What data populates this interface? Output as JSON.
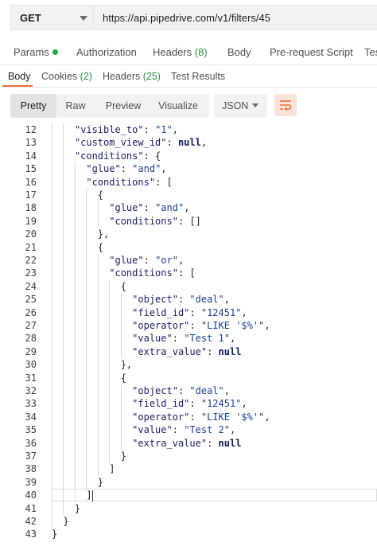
{
  "request": {
    "method": "GET",
    "url": "https://api.pipedrive.com/v1/filters/45"
  },
  "request_tabs": [
    {
      "label": "Params",
      "count": "",
      "dot": true
    },
    {
      "label": "Authorization",
      "count": "",
      "dot": false
    },
    {
      "label": "Headers",
      "count": "(8)",
      "dot": false
    },
    {
      "label": "Body",
      "count": "",
      "dot": false
    },
    {
      "label": "Pre-request Script",
      "count": "",
      "dot": false
    },
    {
      "label": "Tes",
      "count": "",
      "dot": false
    }
  ],
  "response_tabs": [
    {
      "label": "Body",
      "count": "",
      "active": true
    },
    {
      "label": "Cookies",
      "count": "(2)",
      "active": false
    },
    {
      "label": "Headers",
      "count": "(25)",
      "active": false
    },
    {
      "label": "Test Results",
      "count": "",
      "active": false
    }
  ],
  "format_modes": [
    {
      "label": "Pretty",
      "active": true
    },
    {
      "label": "Raw",
      "active": false
    },
    {
      "label": "Preview",
      "active": false
    },
    {
      "label": "Visualize",
      "active": false
    }
  ],
  "language": "JSON",
  "wrap_icon": "wrap-lines-icon",
  "colors": {
    "accent": "#f26b3a",
    "count_green": "#2f9142",
    "dot_green": "#27a844",
    "json_key": "#1c1c6b",
    "json_string": "#1c3f96",
    "json_null": "#0b1a63"
  },
  "code_lines": [
    {
      "n": "12",
      "indent": 4,
      "tokens": [
        [
          "k",
          "\"visible_to\""
        ],
        [
          "p",
          ": "
        ],
        [
          "s",
          "\"1\""
        ],
        [
          "p",
          ","
        ]
      ]
    },
    {
      "n": "13",
      "indent": 4,
      "tokens": [
        [
          "k",
          "\"custom_view_id\""
        ],
        [
          "p",
          ": "
        ],
        [
          "n",
          "null"
        ],
        [
          "p",
          ","
        ]
      ]
    },
    {
      "n": "14",
      "indent": 4,
      "tokens": [
        [
          "k",
          "\"conditions\""
        ],
        [
          "p",
          ": {"
        ]
      ]
    },
    {
      "n": "15",
      "indent": 6,
      "tokens": [
        [
          "k",
          "\"glue\""
        ],
        [
          "p",
          ": "
        ],
        [
          "s",
          "\"and\""
        ],
        [
          "p",
          ","
        ]
      ]
    },
    {
      "n": "16",
      "indent": 6,
      "tokens": [
        [
          "k",
          "\"conditions\""
        ],
        [
          "p",
          ": ["
        ]
      ]
    },
    {
      "n": "17",
      "indent": 8,
      "tokens": [
        [
          "p",
          "{"
        ]
      ]
    },
    {
      "n": "18",
      "indent": 10,
      "tokens": [
        [
          "k",
          "\"glue\""
        ],
        [
          "p",
          ": "
        ],
        [
          "s",
          "\"and\""
        ],
        [
          "p",
          ","
        ]
      ]
    },
    {
      "n": "19",
      "indent": 10,
      "tokens": [
        [
          "k",
          "\"conditions\""
        ],
        [
          "p",
          ": []"
        ]
      ]
    },
    {
      "n": "20",
      "indent": 8,
      "tokens": [
        [
          "p",
          "},"
        ]
      ]
    },
    {
      "n": "21",
      "indent": 8,
      "tokens": [
        [
          "p",
          "{"
        ]
      ]
    },
    {
      "n": "22",
      "indent": 10,
      "tokens": [
        [
          "k",
          "\"glue\""
        ],
        [
          "p",
          ": "
        ],
        [
          "s",
          "\"or\""
        ],
        [
          "p",
          ","
        ]
      ]
    },
    {
      "n": "23",
      "indent": 10,
      "tokens": [
        [
          "k",
          "\"conditions\""
        ],
        [
          "p",
          ": ["
        ]
      ]
    },
    {
      "n": "24",
      "indent": 12,
      "tokens": [
        [
          "p",
          "{"
        ]
      ]
    },
    {
      "n": "25",
      "indent": 14,
      "tokens": [
        [
          "k",
          "\"object\""
        ],
        [
          "p",
          ": "
        ],
        [
          "s",
          "\"deal\""
        ],
        [
          "p",
          ","
        ]
      ]
    },
    {
      "n": "26",
      "indent": 14,
      "tokens": [
        [
          "k",
          "\"field_id\""
        ],
        [
          "p",
          ": "
        ],
        [
          "s",
          "\"12451\""
        ],
        [
          "p",
          ","
        ]
      ]
    },
    {
      "n": "27",
      "indent": 14,
      "tokens": [
        [
          "k",
          "\"operator\""
        ],
        [
          "p",
          ": "
        ],
        [
          "s",
          "\"LIKE '$%'\""
        ],
        [
          "p",
          ","
        ]
      ]
    },
    {
      "n": "28",
      "indent": 14,
      "tokens": [
        [
          "k",
          "\"value\""
        ],
        [
          "p",
          ": "
        ],
        [
          "s",
          "\"Test 1\""
        ],
        [
          "p",
          ","
        ]
      ]
    },
    {
      "n": "29",
      "indent": 14,
      "tokens": [
        [
          "k",
          "\"extra_value\""
        ],
        [
          "p",
          ": "
        ],
        [
          "n",
          "null"
        ]
      ]
    },
    {
      "n": "30",
      "indent": 12,
      "tokens": [
        [
          "p",
          "},"
        ]
      ]
    },
    {
      "n": "31",
      "indent": 12,
      "tokens": [
        [
          "p",
          "{"
        ]
      ]
    },
    {
      "n": "32",
      "indent": 14,
      "tokens": [
        [
          "k",
          "\"object\""
        ],
        [
          "p",
          ": "
        ],
        [
          "s",
          "\"deal\""
        ],
        [
          "p",
          ","
        ]
      ]
    },
    {
      "n": "33",
      "indent": 14,
      "tokens": [
        [
          "k",
          "\"field_id\""
        ],
        [
          "p",
          ": "
        ],
        [
          "s",
          "\"12451\""
        ],
        [
          "p",
          ","
        ]
      ]
    },
    {
      "n": "34",
      "indent": 14,
      "tokens": [
        [
          "k",
          "\"operator\""
        ],
        [
          "p",
          ": "
        ],
        [
          "s",
          "\"LIKE '$%'\""
        ],
        [
          "p",
          ","
        ]
      ]
    },
    {
      "n": "35",
      "indent": 14,
      "tokens": [
        [
          "k",
          "\"value\""
        ],
        [
          "p",
          ": "
        ],
        [
          "s",
          "\"Test 2\""
        ],
        [
          "p",
          ","
        ]
      ]
    },
    {
      "n": "36",
      "indent": 14,
      "tokens": [
        [
          "k",
          "\"extra_value\""
        ],
        [
          "p",
          ": "
        ],
        [
          "n",
          "null"
        ]
      ]
    },
    {
      "n": "37",
      "indent": 12,
      "tokens": [
        [
          "p",
          "}"
        ]
      ]
    },
    {
      "n": "38",
      "indent": 10,
      "tokens": [
        [
          "p",
          "]"
        ]
      ]
    },
    {
      "n": "39",
      "indent": 8,
      "tokens": [
        [
          "p",
          "}"
        ]
      ]
    },
    {
      "n": "40",
      "indent": 6,
      "tokens": [
        [
          "p",
          "]"
        ]
      ]
    },
    {
      "n": "41",
      "indent": 4,
      "tokens": [
        [
          "p",
          "}"
        ]
      ]
    },
    {
      "n": "42",
      "indent": 2,
      "tokens": [
        [
          "p",
          "}"
        ]
      ]
    },
    {
      "n": "43",
      "indent": 0,
      "tokens": [
        [
          "p",
          "}"
        ]
      ]
    }
  ],
  "cursor_line": "40"
}
